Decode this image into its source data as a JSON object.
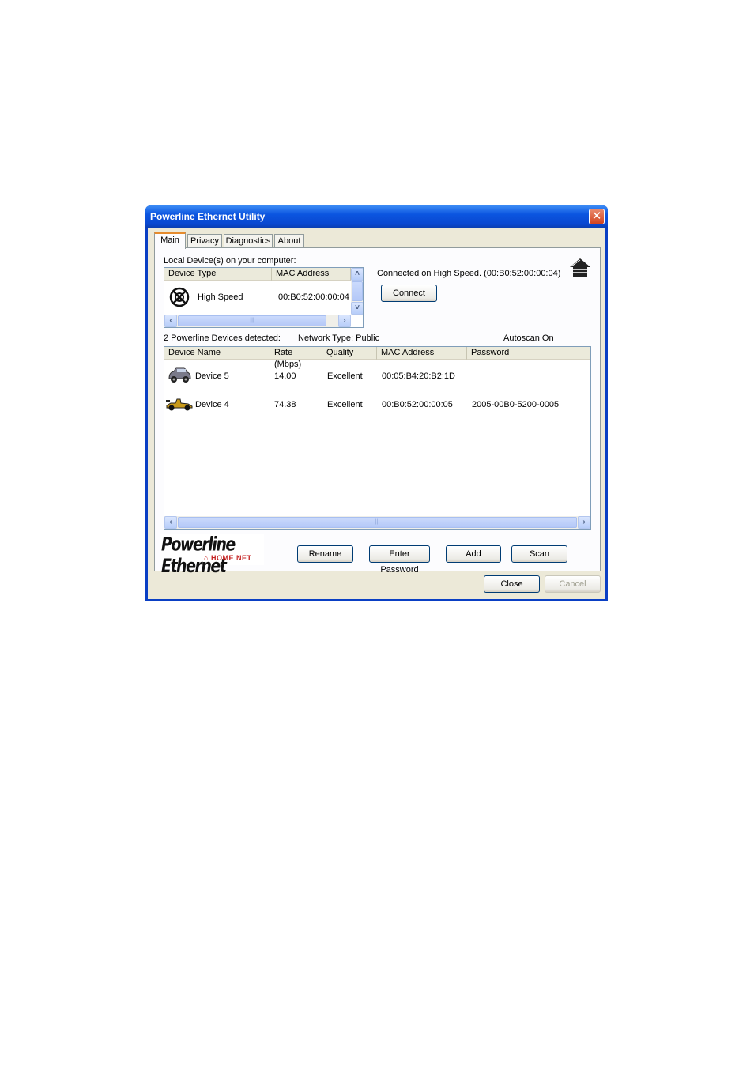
{
  "window": {
    "title": "Powerline Ethernet Utility"
  },
  "tabs": [
    {
      "label": "Main",
      "active": true
    },
    {
      "label": "Privacy",
      "active": false
    },
    {
      "label": "Diagnostics",
      "active": false
    },
    {
      "label": "About",
      "active": false
    }
  ],
  "local": {
    "section_label": "Local Device(s) on your computer:",
    "columns": [
      "Device Type",
      "MAC Address"
    ],
    "device": {
      "type": "High Speed",
      "mac": "00:B0:52:00:00:04",
      "icon": "powerline-adapter-icon"
    },
    "connected_text": "Connected on  High Speed. (00:B0:52:00:00:04)",
    "connect_button": "Connect"
  },
  "status": {
    "detected": "2 Powerline Devices detected:",
    "network_type": "Network Type: Public",
    "autoscan": "Autoscan On"
  },
  "remote": {
    "columns": [
      "Device Name",
      "Rate (Mbps)",
      "Quality",
      "MAC Address",
      "Password"
    ],
    "rows": [
      {
        "name": "Device 5",
        "rate": "14.00",
        "quality": "Excellent",
        "mac": "00:05:B4:20:B2:1D",
        "password": "",
        "icon": "car-icon"
      },
      {
        "name": "Device 4",
        "rate": "74.38",
        "quality": "Excellent",
        "mac": "00:B0:52:00:00:05",
        "password": "2005-00B0-5200-0005",
        "icon": "race-car-icon"
      }
    ]
  },
  "logo": {
    "main": "Powerline Ethernet",
    "sub": "HOME NET"
  },
  "actions": {
    "rename": "Rename",
    "enter_password": "Enter Password",
    "add": "Add",
    "scan": "Scan"
  },
  "dialog": {
    "close": "Close",
    "cancel": "Cancel"
  }
}
